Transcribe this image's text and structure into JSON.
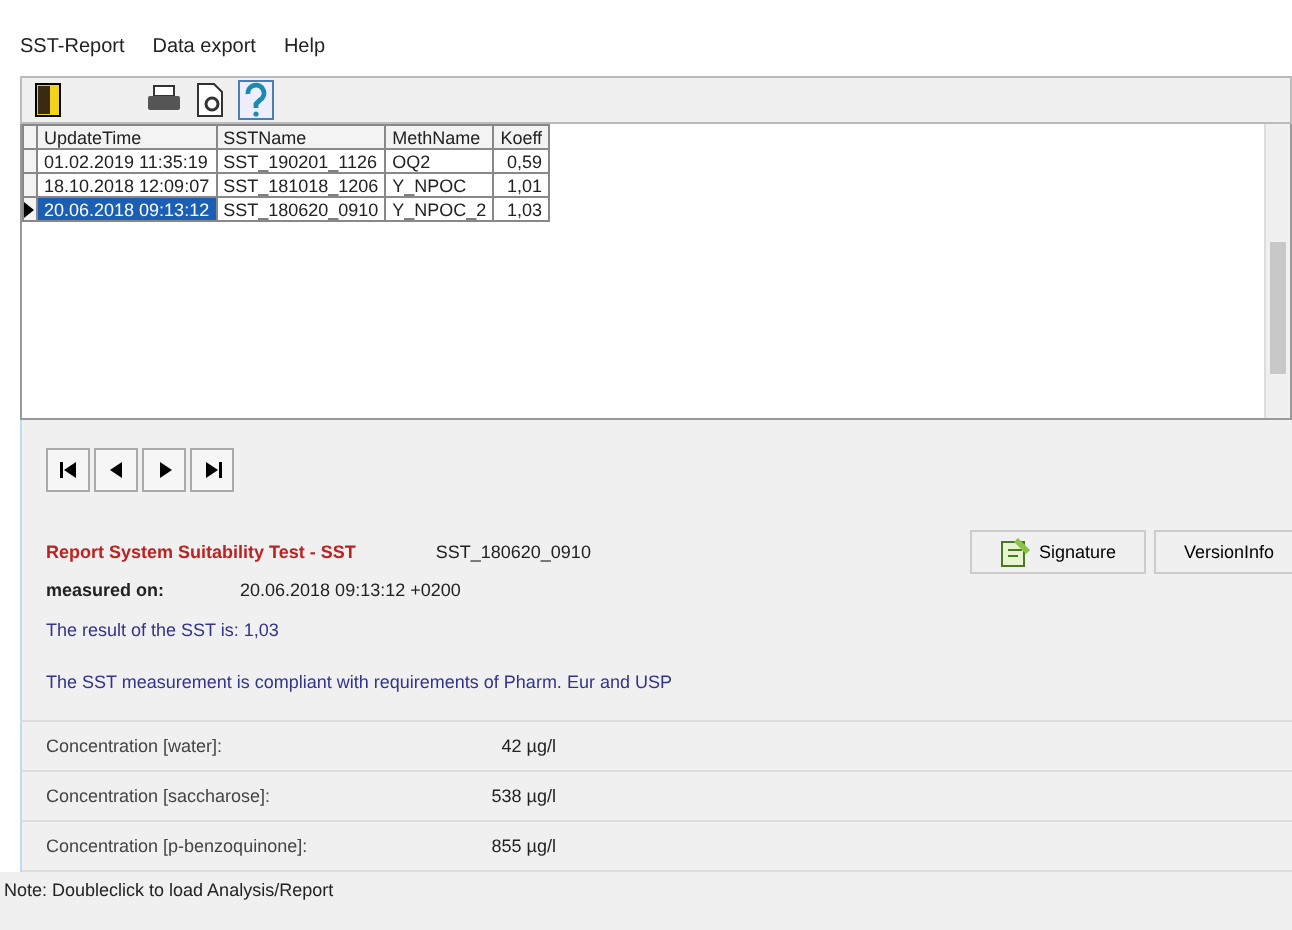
{
  "menu": [
    "SST-Report",
    "Data export",
    "Help"
  ],
  "grid": {
    "columns": [
      "UpdateTime",
      "SSTName",
      "MethName",
      "Koeff"
    ],
    "rows": [
      {
        "cells": [
          "01.02.2019 11:35:19",
          "SST_190201_1126",
          "OQ2",
          "0,59"
        ],
        "selected": false
      },
      {
        "cells": [
          "18.10.2018 12:09:07",
          "SST_181018_1206",
          "Y_NPOC",
          "1,01"
        ],
        "selected": false
      },
      {
        "cells": [
          "20.06.2018 09:13:12",
          "SST_180620_0910",
          "Y_NPOC_2",
          "1,03"
        ],
        "selected": true
      }
    ]
  },
  "report": {
    "title": "Report System Suitability Test - SST",
    "sst_name": "SST_180620_0910",
    "measured_label": "measured on:",
    "measured_value": "20.06.2018 09:13:12 +0200",
    "result": "The result of the SST is: 1,03",
    "compliance": "The SST measurement is compliant with requirements of Pharm. Eur and USP"
  },
  "buttons": [
    "Signature",
    "VersionInfo"
  ],
  "concentrations": [
    {
      "label": "Concentration [water]:",
      "value": "42 µg/l"
    },
    {
      "label": "Concentration [saccharose]:",
      "value": "538 µg/l"
    },
    {
      "label": "Concentration [p-benzoquinone]:",
      "value": "855 µg/l"
    }
  ],
  "note": "Note: Doubleclick to load Analysis/Report"
}
